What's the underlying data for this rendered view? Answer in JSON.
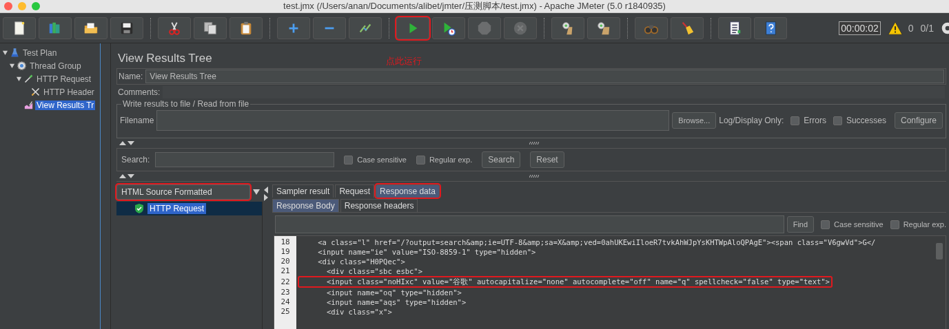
{
  "window": {
    "title": "test.jmx (/Users/anan/Documents/alibet/jmter/压测脚本/test.jmx) - Apache JMeter (5.0 r1840935)"
  },
  "toolbar": [
    [
      {
        "kind": "new",
        "disabled": false,
        "highlighted": false
      },
      {
        "kind": "templates",
        "disabled": false,
        "highlighted": false
      },
      {
        "kind": "open",
        "disabled": false,
        "highlighted": false
      },
      {
        "kind": "save",
        "disabled": false,
        "highlighted": false
      }
    ],
    [
      {
        "kind": "cut",
        "disabled": false,
        "highlighted": false
      },
      {
        "kind": "copy",
        "disabled": false,
        "highlighted": false
      },
      {
        "kind": "paste",
        "disabled": false,
        "highlighted": false
      }
    ],
    [
      {
        "kind": "expand",
        "disabled": false,
        "highlighted": false
      },
      {
        "kind": "collapse",
        "disabled": false,
        "highlighted": false
      },
      {
        "kind": "toggle",
        "disabled": false,
        "highlighted": false
      }
    ],
    [
      {
        "kind": "start",
        "disabled": false,
        "highlighted": true
      },
      {
        "kind": "start-no-timers",
        "disabled": false,
        "highlighted": false
      },
      {
        "kind": "stop",
        "disabled": true,
        "highlighted": false
      },
      {
        "kind": "shutdown",
        "disabled": true,
        "highlighted": false
      }
    ],
    [
      {
        "kind": "clear",
        "disabled": false,
        "highlighted": false
      },
      {
        "kind": "clear-all",
        "disabled": false,
        "highlighted": false
      }
    ],
    [
      {
        "kind": "search",
        "disabled": false,
        "highlighted": false
      },
      {
        "kind": "reset-search",
        "disabled": false,
        "highlighted": false
      }
    ],
    [
      {
        "kind": "function-helper",
        "disabled": false,
        "highlighted": false
      },
      {
        "kind": "help",
        "disabled": false,
        "highlighted": false
      }
    ]
  ],
  "status": {
    "timer": "00:00:02",
    "warnings": "0",
    "threads": "0/1"
  },
  "annotation": "点此运行",
  "tree": [
    {
      "label": "Test Plan",
      "kind": "test-plan",
      "expanded": true,
      "selected": false,
      "children": [
        {
          "label": "Thread Group",
          "kind": "thread-group",
          "expanded": true,
          "selected": false,
          "children": [
            {
              "label": "HTTP Request",
              "kind": "sampler",
              "expanded": true,
              "selected": false,
              "children": [
                {
                  "label": "HTTP Header",
                  "kind": "config",
                  "selected": false
                }
              ]
            },
            {
              "label": "View Results Tr",
              "kind": "listener",
              "selected": true
            }
          ]
        }
      ]
    }
  ],
  "panel": {
    "title": "View Results Tree",
    "name_label": "Name:",
    "name_value": "View Results Tree",
    "comments_label": "Comments:",
    "file_group": {
      "legend": "Write results to file / Read from file",
      "filename_label": "Filename",
      "browse": "Browse...",
      "log_label": "Log/Display Only:",
      "checkboxes": [
        {
          "label": "Errors",
          "checked": false
        },
        {
          "label": "Successes",
          "checked": false
        }
      ],
      "configure": "Configure"
    },
    "search": {
      "label": "Search:",
      "checkboxes": [
        {
          "label": "Case sensitive",
          "checked": false
        },
        {
          "label": "Regular exp.",
          "checked": false
        }
      ],
      "buttons": [
        "Search",
        "Reset"
      ]
    },
    "renderer": {
      "value": "HTML Source Formatted",
      "highlighted": true
    },
    "results": [
      {
        "label": "HTTP Request",
        "passed": true,
        "selected": true
      }
    ],
    "tabs": [
      {
        "label": "Sampler result",
        "selected": false,
        "highlighted": false
      },
      {
        "label": "Request",
        "selected": false,
        "highlighted": false
      },
      {
        "label": "Response data",
        "selected": true,
        "highlighted": true
      }
    ],
    "subtabs": [
      {
        "label": "Response Body",
        "selected": true
      },
      {
        "label": "Response headers",
        "selected": false
      }
    ],
    "find": {
      "button": "Find",
      "checkboxes": [
        {
          "label": "Case sensitive",
          "checked": false
        },
        {
          "label": "Regular exp.",
          "checked": false
        }
      ]
    },
    "code": [
      {
        "number": "18",
        "text": "    <a class=\"l\" href=\"/?output=search&amp;ie=UTF-8&amp;sa=X&amp;ved=0ahUKEwiIloeR7tvkAhWJpYsKHTWpAloQPAgE\"><span class=\"V6gwVd\">G</",
        "highlighted": false
      },
      {
        "number": "19",
        "text": "    <input name=\"ie\" value=\"ISO-8859-1\" type=\"hidden\">",
        "highlighted": false
      },
      {
        "number": "20",
        "text": "    <div class=\"H0PQec\">",
        "highlighted": false
      },
      {
        "number": "21",
        "text": "      <div class=\"sbc esbc\">",
        "highlighted": false
      },
      {
        "number": "22",
        "text": "      <input class=\"noHIxc\" value=\"谷歌\" autocapitalize=\"none\" autocomplete=\"off\" name=\"q\" spellcheck=\"false\" type=\"text\">",
        "highlighted": true
      },
      {
        "number": "23",
        "text": "      <input name=\"oq\" type=\"hidden\">",
        "highlighted": false
      },
      {
        "number": "24",
        "text": "      <input name=\"aqs\" type=\"hidden\">",
        "highlighted": false
      },
      {
        "number": "25",
        "text": "      <div class=\"x\">",
        "highlighted": false
      }
    ]
  }
}
